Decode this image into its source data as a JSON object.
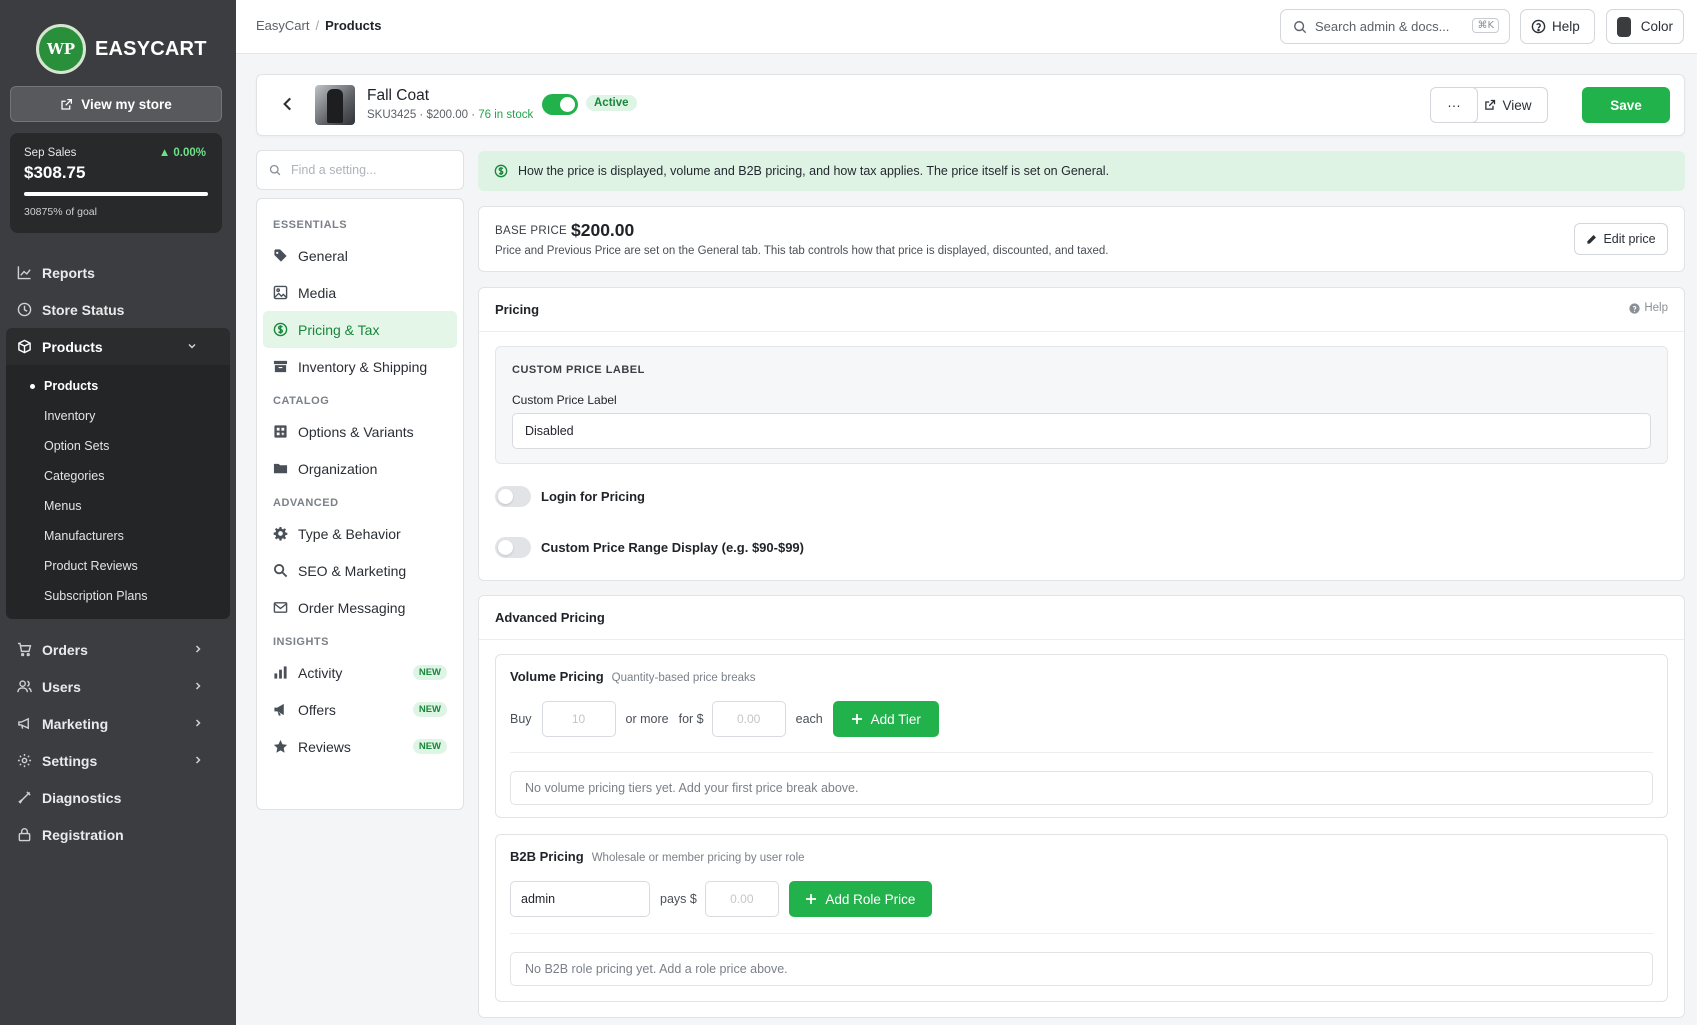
{
  "brand": {
    "logo_text": "WP",
    "name": "EASYCART"
  },
  "sidebar": {
    "view_store_label": "View my store",
    "sales": {
      "label": "Sep Sales",
      "change": "▲ 0.00%",
      "amount": "$308.75",
      "goal_progress": 1.0,
      "goal_text": "30875% of goal"
    },
    "nav": [
      {
        "label": "Reports",
        "icon": "chart-line-icon"
      },
      {
        "label": "Store Status",
        "icon": "clock-icon"
      },
      {
        "label": "Products",
        "icon": "box-icon",
        "expanded": true
      },
      {
        "label": "Orders",
        "icon": "cart-icon"
      },
      {
        "label": "Users",
        "icon": "users-icon"
      },
      {
        "label": "Marketing",
        "icon": "megaphone-icon"
      },
      {
        "label": "Settings",
        "icon": "gear-icon"
      },
      {
        "label": "Diagnostics",
        "icon": "wrench-icon"
      },
      {
        "label": "Registration",
        "icon": "lock-icon"
      }
    ],
    "products_sub": [
      "Products",
      "Inventory",
      "Option Sets",
      "Categories",
      "Menus",
      "Manufacturers",
      "Product Reviews",
      "Subscription Plans"
    ]
  },
  "topbar": {
    "breadcrumb_root": "EasyCart",
    "breadcrumb_sep": "/",
    "breadcrumb_current": "Products",
    "search_placeholder": "Search admin & docs...",
    "search_shortcut": "⌘K",
    "help_label": "Help",
    "color_label": "Color"
  },
  "product": {
    "name": "Fall Coat",
    "sku_price": "SKU3425 · $200.00 · ",
    "stock": "76 in stock",
    "status": "Active",
    "view_label": "View",
    "more_label": "···",
    "save_label": "Save"
  },
  "settings_menu": {
    "search_placeholder": "Find a setting...",
    "groups": [
      {
        "title": "ESSENTIALS",
        "items": [
          {
            "label": "General",
            "icon": "tag-icon"
          },
          {
            "label": "Media",
            "icon": "image-icon"
          },
          {
            "label": "Pricing & Tax",
            "icon": "dollar-circle-icon",
            "selected": true
          },
          {
            "label": "Inventory & Shipping",
            "icon": "archive-icon"
          }
        ]
      },
      {
        "title": "CATALOG",
        "items": [
          {
            "label": "Options & Variants",
            "icon": "grid-plus-icon"
          },
          {
            "label": "Organization",
            "icon": "folder-icon"
          }
        ]
      },
      {
        "title": "ADVANCED",
        "items": [
          {
            "label": "Type & Behavior",
            "icon": "gear-icon"
          },
          {
            "label": "SEO & Marketing",
            "icon": "search-icon"
          },
          {
            "label": "Order Messaging",
            "icon": "mail-icon"
          }
        ]
      },
      {
        "title": "INSIGHTS",
        "items": [
          {
            "label": "Activity",
            "icon": "bar-chart-icon",
            "badge": "NEW"
          },
          {
            "label": "Offers",
            "icon": "megaphone-icon",
            "badge": "NEW"
          },
          {
            "label": "Reviews",
            "icon": "star-icon",
            "badge": "NEW"
          }
        ]
      }
    ]
  },
  "banner": {
    "text": "How the price is displayed, volume and B2B pricing, and how tax applies. The price itself is set on General."
  },
  "base_price": {
    "label": "BASE PRICE",
    "value": "$200.00",
    "description": "Price and Previous Price are set on the General tab. This tab controls how that price is displayed, discounted, and taxed.",
    "edit_label": "Edit price"
  },
  "pricing": {
    "title": "Pricing",
    "help_label": "Help",
    "custom_price_label_title": "CUSTOM PRICE LABEL",
    "custom_price_label_field": "Custom Price Label",
    "custom_price_label_value": "Disabled",
    "login_for_pricing": "Login for Pricing",
    "login_for_pricing_on": false,
    "range_display": "Custom Price Range Display (e.g. $90-$99)",
    "range_display_on": false
  },
  "advanced": {
    "title": "Advanced Pricing",
    "volume": {
      "title": "Volume Pricing",
      "hint": "Quantity-based price breaks",
      "buy_label": "Buy",
      "qty_placeholder": "10",
      "or_more_label": "or more",
      "for_label": "for $",
      "price_placeholder": "0.00",
      "each_label": "each",
      "add_label": "Add Tier",
      "empty": "No volume pricing tiers yet. Add your first price break above."
    },
    "b2b": {
      "title": "B2B Pricing",
      "hint": "Wholesale or member pricing by user role",
      "role_value": "admin",
      "pays_label": "pays $",
      "price_placeholder": "0.00",
      "add_label": "Add Role Price",
      "empty": "No B2B role pricing yet. Add a role price above."
    }
  }
}
